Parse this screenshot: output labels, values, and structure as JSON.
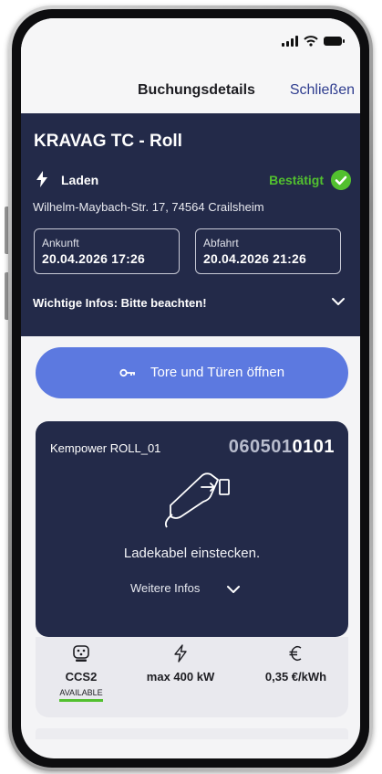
{
  "nav": {
    "title": "Buchungsdetails",
    "close_label": "Schließen"
  },
  "booking": {
    "title": "KRAVAG TC - Roll",
    "charge_label": "Laden",
    "status": "Bestätigt",
    "address": "Wilhelm-Maybach-Str. 17, 74564 Crailsheim",
    "arrival": {
      "label": "Ankunft",
      "value": "20.04.2026 17:26"
    },
    "departure": {
      "label": "Abfahrt",
      "value": "20.04.2026 21:26"
    },
    "important_info": "Wichtige Infos: Bitte beachten!"
  },
  "open_button": {
    "label": "Tore und Türen öffnen"
  },
  "charge_point": {
    "name": "Kempower ROLL_01",
    "id_prefix": "060501",
    "id_suffix": "0101",
    "message": "Ladekabel einstecken.",
    "more_label": "Weitere Infos"
  },
  "specs": {
    "connector": "CCS2",
    "connector_status": "AVAILABLE",
    "power": "max 400 kW",
    "price": "0,35 €/kWh"
  },
  "icons": [
    "signal-icon",
    "wifi-icon",
    "battery-icon",
    "bolt-icon",
    "check-circle-icon",
    "chevron-down-icon",
    "key-icon",
    "charging-plug-icon",
    "connector-icon",
    "power-icon",
    "euro-icon"
  ],
  "colors": {
    "navy": "#232a49",
    "accent_blue": "#5c79e0",
    "success_green": "#52c02f",
    "link_blue": "#2f3d8f"
  }
}
